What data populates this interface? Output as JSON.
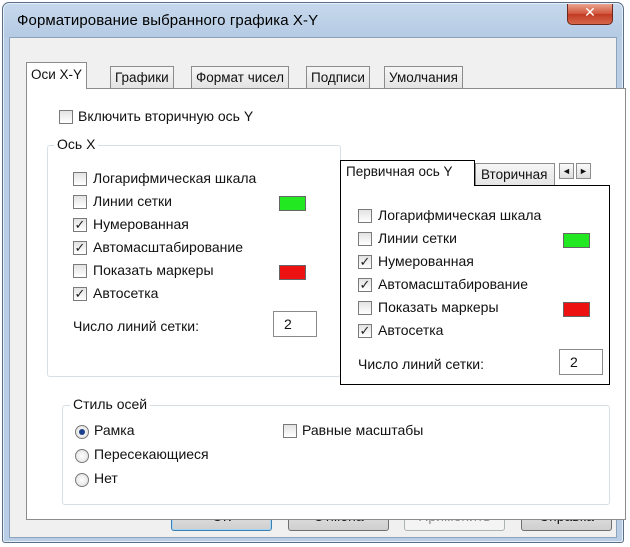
{
  "window": {
    "title": "Форматирование выбранного графика X-Y",
    "close_glyph": "✕"
  },
  "tabs": [
    {
      "label": "Оси X-Y",
      "active": true
    },
    {
      "label": "Графики",
      "active": false
    },
    {
      "label": "Формат чисел",
      "active": false
    },
    {
      "label": "Подписи",
      "active": false
    },
    {
      "label": "Умолчания",
      "active": false
    }
  ],
  "secondary_y": {
    "label": "Включить вторичную ось Y",
    "checked": false
  },
  "axis_x": {
    "legend": "Ось X",
    "log_scale": {
      "label": "Логарифмическая шкала",
      "checked": false
    },
    "grid_lines": {
      "label": "Линии сетки",
      "checked": false,
      "color": "#22e822"
    },
    "numbered": {
      "label": "Нумерованная",
      "checked": true
    },
    "autoscale": {
      "label": "Автомасштабирование",
      "checked": true
    },
    "markers": {
      "label": "Показать маркеры",
      "checked": false,
      "color": "#ee1111"
    },
    "autogrid": {
      "label": "Автосетка",
      "checked": true
    },
    "grid_count": {
      "label": "Число линий сетки:",
      "value": "2"
    }
  },
  "axis_y": {
    "tabs": [
      "Первичная ось Y",
      "Вторичная"
    ],
    "scroll_left": "◄",
    "scroll_right": "►",
    "log_scale": {
      "label": "Логарифмическая шкала",
      "checked": false
    },
    "grid_lines": {
      "label": "Линии сетки",
      "checked": false,
      "color": "#22e822"
    },
    "numbered": {
      "label": "Нумерованная",
      "checked": true
    },
    "autoscale": {
      "label": "Автомасштабирование",
      "checked": true
    },
    "markers": {
      "label": "Показать маркеры",
      "checked": false,
      "color": "#ee1111"
    },
    "autogrid": {
      "label": "Автосетка",
      "checked": true
    },
    "grid_count": {
      "label": "Число линий сетки:",
      "value": "2"
    }
  },
  "axis_style": {
    "legend": "Стиль осей",
    "options": [
      {
        "label": "Рамка",
        "selected": true
      },
      {
        "label": "Пересекающиеся",
        "selected": false
      },
      {
        "label": "Нет",
        "selected": false
      }
    ],
    "equal_scales": {
      "label": "Равные масштабы",
      "checked": false
    }
  },
  "buttons": {
    "ok": "ОК",
    "cancel": "Отмена",
    "apply": "Применить",
    "help": "Справка"
  },
  "check_glyph": "✓"
}
